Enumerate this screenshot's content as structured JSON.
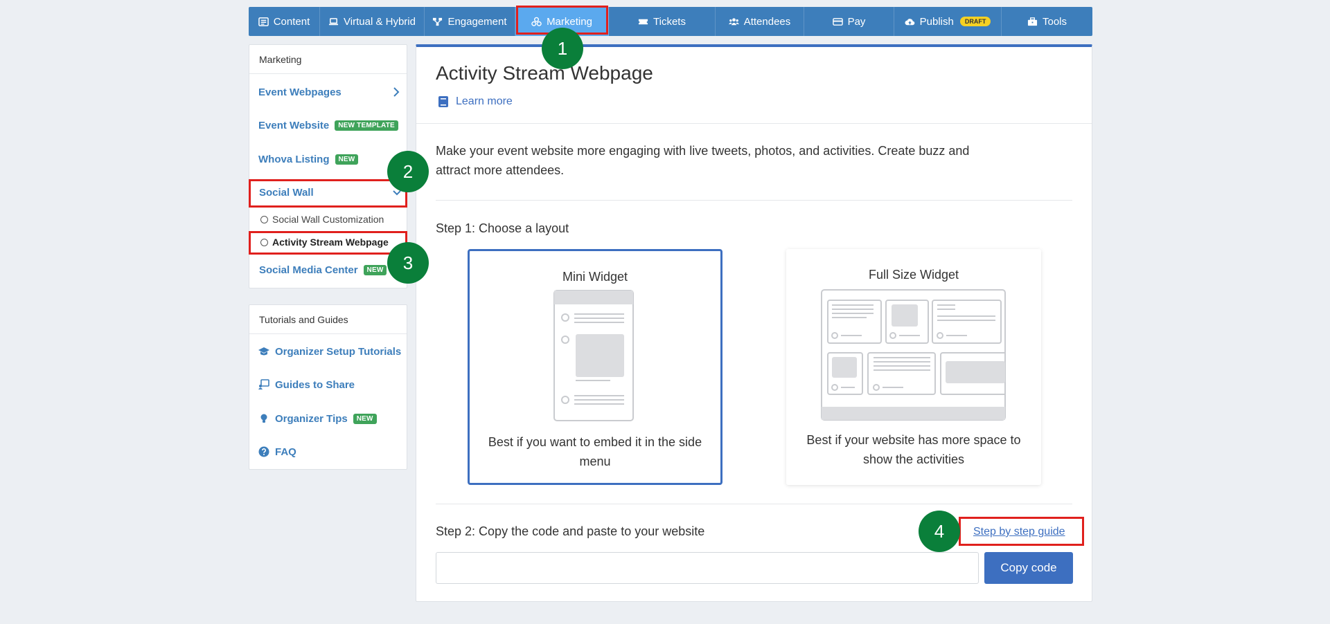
{
  "topnav": {
    "items": [
      {
        "label": "Content",
        "icon": "content-icon"
      },
      {
        "label": "Virtual & Hybrid",
        "icon": "laptop-icon"
      },
      {
        "label": "Engagement",
        "icon": "network-icon"
      },
      {
        "label": "Marketing",
        "icon": "marketing-icon"
      },
      {
        "label": "Tickets",
        "icon": "ticket-icon"
      },
      {
        "label": "Attendees",
        "icon": "users-icon"
      },
      {
        "label": "Pay",
        "icon": "card-icon"
      },
      {
        "label": "Publish",
        "icon": "cloud-upload-icon",
        "badge": "DRAFT"
      },
      {
        "label": "Tools",
        "icon": "toolbox-icon"
      }
    ],
    "active_index": 3,
    "color": "#3d7ebb",
    "active_color": "#5ba9ee"
  },
  "sidebar": {
    "marketing_header": "Marketing",
    "items": [
      {
        "label": "Event Webpages"
      },
      {
        "label": "Event Website",
        "badge": "NEW TEMPLATE"
      },
      {
        "label": "Whova Listing",
        "badge": "NEW"
      },
      {
        "label": "Social Wall"
      },
      {
        "label": "Social Media Center",
        "badge": "NEW"
      }
    ],
    "social_wall_sub": [
      {
        "label": "Social Wall Customization"
      },
      {
        "label": "Activity Stream Webpage"
      }
    ],
    "tutorials_header": "Tutorials and Guides",
    "tutorial_items": [
      {
        "label": "Organizer Setup Tutorials",
        "icon": "graduation-cap-icon"
      },
      {
        "label": "Guides to Share",
        "icon": "share-screen-icon"
      },
      {
        "label": "Organizer Tips",
        "icon": "lightbulb-icon",
        "badge": "NEW"
      },
      {
        "label": "FAQ",
        "icon": "question-circle-icon"
      }
    ]
  },
  "main": {
    "title": "Activity Stream Webpage",
    "learn_more": "Learn more",
    "intro": "Make your event website more engaging with live tweets, photos, and activities. Create buzz and attract more attendees.",
    "step1_label": "Step 1: Choose a layout",
    "layouts": [
      {
        "title": "Mini Widget",
        "desc": "Best if you want to embed it in the side menu",
        "selected": true
      },
      {
        "title": "Full Size Widget",
        "desc": "Best if your website has more space to show the activities",
        "selected": false
      }
    ],
    "step2_label": "Step 2: Copy the code and paste to your website",
    "step_guide_link": "Step by step guide",
    "code_value": "",
    "copy_button": "Copy code"
  },
  "annotations": {
    "steps": [
      "1",
      "2",
      "3",
      "4"
    ],
    "highlight_color": "#e0201d",
    "circle_color": "#0a7f3a"
  }
}
